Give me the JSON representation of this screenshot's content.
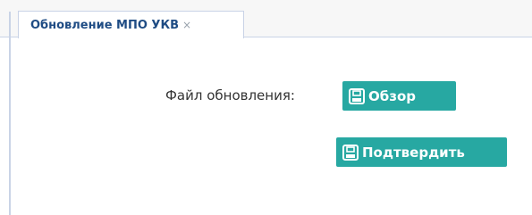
{
  "tab": {
    "label": "Обновление МПО УКВ",
    "close": "×"
  },
  "form": {
    "file_label": "Файл обновления:",
    "browse_label": "Обзор",
    "browse_icon": "save-icon",
    "confirm_label": "Подтвердить",
    "confirm_icon": "save-icon"
  },
  "colors": {
    "button": "#27a8a2",
    "tab_text": "#1f4c84",
    "border": "#c9d3e6"
  }
}
